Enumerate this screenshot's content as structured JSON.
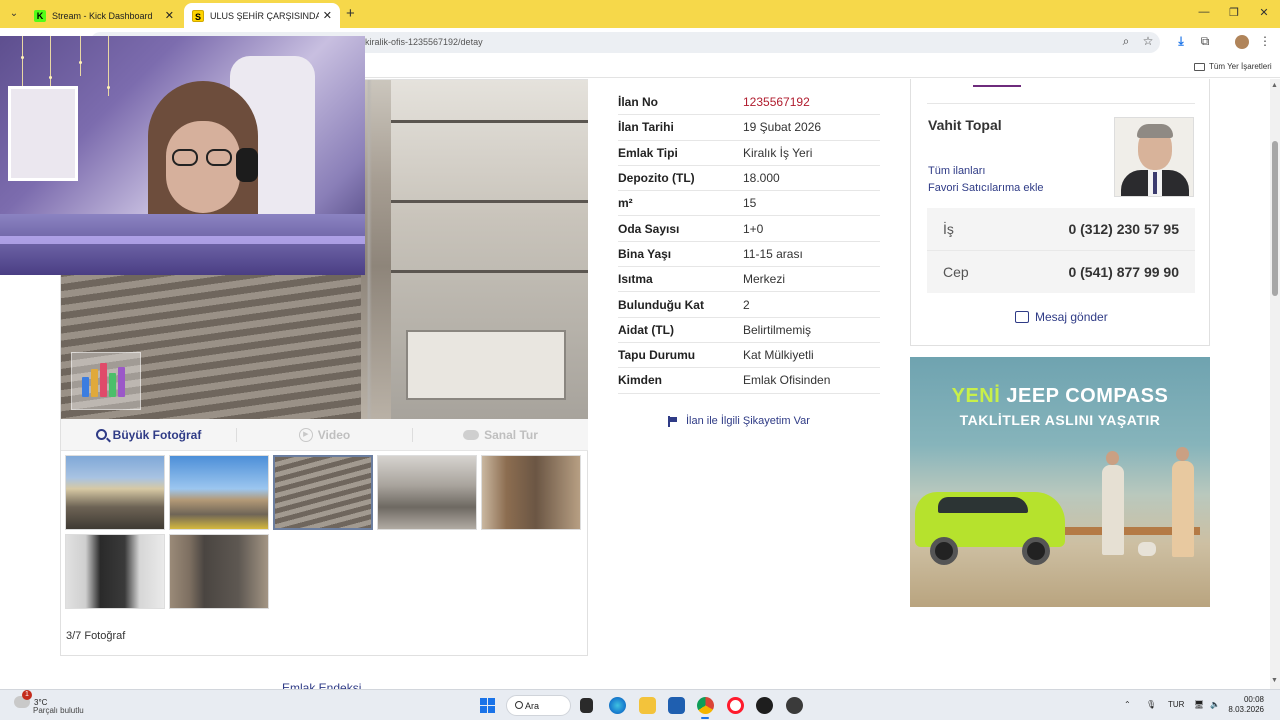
{
  "browser": {
    "tabs": [
      {
        "title": "Stream - Kick Dashboard",
        "favicon": "kick-icon",
        "active": false
      },
      {
        "title": "ULUS ŞEHİR ÇARŞISINDA KİRAL",
        "favicon": "sahibinden-icon",
        "active": true
      }
    ],
    "url": "kiralik-ofis-1235567192/detay",
    "bookmarks_folder": "Tüm Yer İşaretleri"
  },
  "gallery": {
    "actions": [
      {
        "label": "Büyük Fotoğraf",
        "icon": "magnifier-icon",
        "enabled": true
      },
      {
        "label": "Video",
        "icon": "play-icon",
        "enabled": false
      },
      {
        "label": "Sanal Tur",
        "icon": "cloud-icon",
        "enabled": false
      }
    ],
    "thumbnail_count": 7,
    "selected_index": 3,
    "counter": "3/7 Fotoğraf"
  },
  "details": [
    {
      "label": "İlan No",
      "value": "1235567192",
      "highlight": true
    },
    {
      "label": "İlan Tarihi",
      "value": "19 Şubat 2026"
    },
    {
      "label": "Emlak Tipi",
      "value": "Kiralık İş Yeri"
    },
    {
      "label": "Depozito (TL)",
      "value": "18.000"
    },
    {
      "label": "m²",
      "value": "15"
    },
    {
      "label": "Oda Sayısı",
      "value": "1+0"
    },
    {
      "label": "Bina Yaşı",
      "value": "11-15 arası"
    },
    {
      "label": "Isıtma",
      "value": "Merkezi"
    },
    {
      "label": "Bulunduğu Kat",
      "value": "2"
    },
    {
      "label": "Aidat (TL)",
      "value": "Belirtilmemiş"
    },
    {
      "label": "Tapu Durumu",
      "value": "Kat Mülkiyetli"
    },
    {
      "label": "Kimden",
      "value": "Emlak Ofisinden"
    }
  ],
  "complaint_link": "İlan ile İlgili Şikayetim Var",
  "seller": {
    "name": "Vahit Topal",
    "all_listings": "Tüm ilanları",
    "add_favorite": "Favori Satıcılarıma ekle",
    "phones": [
      {
        "label": "İş",
        "number": "0 (312) 230 57 95"
      },
      {
        "label": "Cep",
        "number": "0 (541) 877 99 90"
      }
    ],
    "message_link": "Mesaj gönder"
  },
  "ad": {
    "line1_accent": "YENİ",
    "line1_rest": " JEEP COMPASS",
    "line2": "TAKLİTLER ASLINI YAŞATIR"
  },
  "footer_link": "Emlak Endeksi",
  "taskbar": {
    "weather_temp": "3°C",
    "weather_desc": "Parçalı bulutlu",
    "weather_badge": "1",
    "search_label": "Ara",
    "language": "TUR",
    "time": "00:08",
    "date": "8.03.2026"
  }
}
